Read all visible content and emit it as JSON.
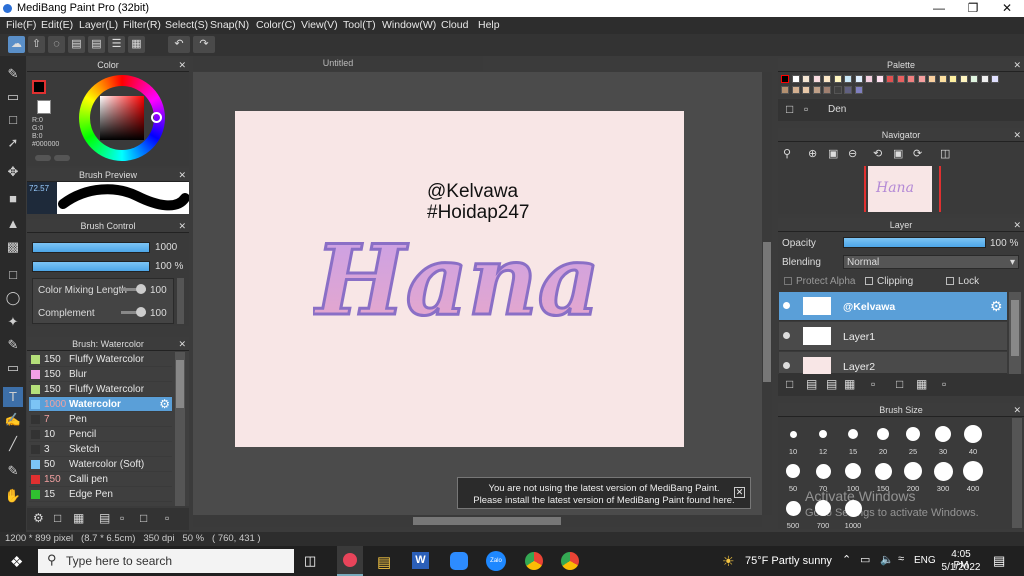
{
  "app": {
    "title": "MediBang Paint Pro (32bit)"
  },
  "menu": [
    "File(F)",
    "Edit(E)",
    "Layer(L)",
    "Filter(R)",
    "Select(S)",
    "Snap(N)",
    "Color(C)",
    "View(V)",
    "Tool(T)",
    "Window(W)",
    "Cloud",
    "Help"
  ],
  "document": {
    "tab": "Untitled",
    "text1": "@Kelvawa",
    "text2": "#Hoidap247",
    "art": "Hana"
  },
  "color_panel": {
    "title": "Color",
    "r": "R:0",
    "g": "G:0",
    "b": "B:0",
    "hex": "#000000"
  },
  "brush_preview": {
    "title": "Brush Preview",
    "size": "72.57"
  },
  "brush_control": {
    "title": "Brush Control",
    "size": "1000",
    "opacity": "100 %",
    "mix_label": "Color Mixing Length",
    "mix_val": "100",
    "comp_label": "Complement",
    "comp_val": "100"
  },
  "brush_list": {
    "title": "Brush: Watercolor",
    "items": [
      {
        "size": "150",
        "name": "Fluffy Watercolor",
        "color": "#b5e07a"
      },
      {
        "size": "150",
        "name": "Blur",
        "color": "#f2a0e6"
      },
      {
        "size": "150",
        "name": "Fluffy Watercolor",
        "color": "#b5e07a"
      },
      {
        "size": "1000",
        "name": "Watercolor",
        "color": "#7cc4f5"
      },
      {
        "size": "7",
        "name": "Pen",
        "color": "#333333"
      },
      {
        "size": "10",
        "name": "Pencil",
        "color": "#333333"
      },
      {
        "size": "3",
        "name": "Sketch",
        "color": "#333333"
      },
      {
        "size": "50",
        "name": "Watercolor (Soft)",
        "color": "#7cc4f5"
      },
      {
        "size": "150",
        "name": "Calli pen",
        "color": "#e03030"
      },
      {
        "size": "15",
        "name": "Edge Pen",
        "color": "#30c030"
      }
    ]
  },
  "palette": {
    "title": "Palette",
    "name": "Den"
  },
  "navigator": {
    "title": "Navigator"
  },
  "layer": {
    "title": "Layer",
    "opacity_label": "Opacity",
    "opacity_val": "100 %",
    "blending_label": "Blending",
    "blending_val": "Normal",
    "protect": "Protect Alpha",
    "clipping": "Clipping",
    "lock": "Lock",
    "layers": [
      "@Kelvawa",
      "Layer1",
      "Layer2"
    ]
  },
  "brush_size": {
    "title": "Brush Size",
    "sizes": [
      "10",
      "12",
      "15",
      "20",
      "25",
      "30",
      "40",
      "50",
      "70",
      "100",
      "150",
      "200",
      "300",
      "400",
      "500",
      "700",
      "1000"
    ]
  },
  "notice": {
    "line1": "You are not using the latest version of MediBang Paint.",
    "line2": "Please install the latest version of MediBang Paint found here."
  },
  "watermark": {
    "line1": "Activate Windows",
    "line2": "Go to Settings to activate Windows."
  },
  "status": {
    "text": "1200 * 899 pixel   (8.7 * 6.5cm)   350 dpi   50 %   ( 760, 431 )"
  },
  "taskbar": {
    "search": "Type here to search",
    "weather": "75°F  Partly sunny",
    "lang": "ENG",
    "time": "4:05 PM",
    "date": "5/1/2022"
  }
}
